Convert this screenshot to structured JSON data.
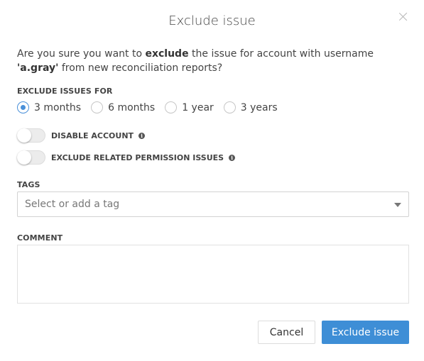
{
  "dialog": {
    "title": "Exclude issue",
    "message_prefix": "Are you sure you want to ",
    "message_bold_action": "exclude",
    "message_middle": " the issue for account with username ",
    "message_bold_user": "'a.gray'",
    "message_suffix": " from new reconciliation reports?"
  },
  "exclude_period": {
    "label": "EXCLUDE ISSUES FOR",
    "options": [
      "3 months",
      "6 months",
      "1 year",
      "3 years"
    ],
    "selected": "3 months"
  },
  "toggles": {
    "disable_account": {
      "label": "DISABLE ACCOUNT",
      "on": false
    },
    "exclude_related": {
      "label": "EXCLUDE RELATED PERMISSION ISSUES",
      "on": false
    }
  },
  "tags": {
    "label": "TAGS",
    "placeholder": "Select or add a tag"
  },
  "comment": {
    "label": "COMMENT",
    "value": ""
  },
  "buttons": {
    "cancel": "Cancel",
    "confirm": "Exclude issue"
  },
  "colors": {
    "accent": "#3e8ed6",
    "radio_selected": "#4a90d9"
  }
}
